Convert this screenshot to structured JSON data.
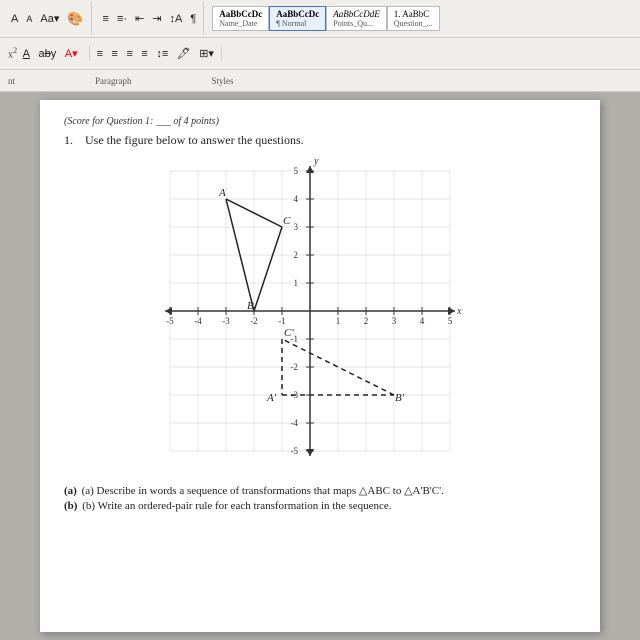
{
  "toolbar": {
    "font_sizes": [
      "A",
      "A",
      "Aa"
    ],
    "styles_label": "Styles",
    "paragraph_label": "Paragraph",
    "style_items": [
      {
        "label": "AaBbCcDc",
        "name": "Name_Date"
      },
      {
        "label": "AaBbCcDc",
        "name": "¶ Normal",
        "active": true
      },
      {
        "label": "AaBbCcDdE",
        "name": "Points_Qu..."
      },
      {
        "label": "1. AaBbC",
        "name": "Question_..."
      }
    ]
  },
  "labels_row": {
    "left": "nt",
    "middle": "Paragraph",
    "right": "Styles"
  },
  "score_line": "(Score for Question 1: ___ of 4 points)",
  "question": {
    "number": "1.",
    "text": "Use the figure below to answer the questions."
  },
  "graph": {
    "x_min": -5,
    "x_max": 5,
    "y_min": -5,
    "y_max": 5,
    "points": {
      "A": {
        "x": -3,
        "y": 4
      },
      "B": {
        "x": -2,
        "y": 0
      },
      "C": {
        "x": -1,
        "y": 3
      },
      "A_prime": {
        "x": -1,
        "y": -3
      },
      "B_prime": {
        "x": 3,
        "y": -3
      },
      "C_prime": {
        "x": -1,
        "y": -1
      }
    }
  },
  "bottom_questions": {
    "a": "(a)  Describe in words a sequence of transformations that maps △ABC to △A'B'C'.",
    "b": "(b)  Write an ordered-pair rule for each transformation in the sequence."
  }
}
